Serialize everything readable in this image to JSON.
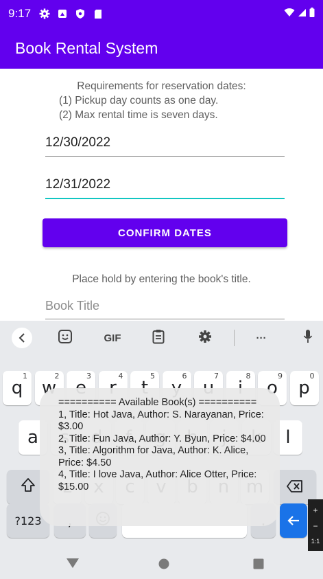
{
  "status_bar": {
    "time": "9:17",
    "icons": [
      "gear-icon",
      "screenshot-icon",
      "shield-icon",
      "sd-card-icon"
    ],
    "right_icons": [
      "wifi-icon",
      "signal-icon",
      "battery-icon"
    ]
  },
  "app_bar": {
    "title": "Book Rental System"
  },
  "requirements": {
    "heading": "Requirements for reservation dates:",
    "rule1": "(1) Pickup day counts as one day.",
    "rule2": "(2) Max rental time is seven days."
  },
  "pickup_date": {
    "value": "12/30/2022"
  },
  "return_date": {
    "value": "12/31/2022"
  },
  "confirm_button": {
    "label": "CONFIRM DATES"
  },
  "hold_hint": "Place hold by entering the book's title.",
  "book_title_input": {
    "placeholder": "Book Title",
    "value": ""
  },
  "keyboard": {
    "toolbar": {
      "gif_label": "GIF",
      "more_label": "···"
    },
    "row1": [
      {
        "key": "q",
        "num": "1"
      },
      {
        "key": "w",
        "num": "2"
      },
      {
        "key": "e",
        "num": "3"
      },
      {
        "key": "r",
        "num": "4"
      },
      {
        "key": "t",
        "num": "5"
      },
      {
        "key": "y",
        "num": "6"
      },
      {
        "key": "u",
        "num": "7"
      },
      {
        "key": "i",
        "num": "8"
      },
      {
        "key": "o",
        "num": "9"
      },
      {
        "key": "p",
        "num": "0"
      }
    ],
    "row2": [
      "a",
      "s",
      "d",
      "f",
      "g",
      "h",
      "j",
      "k",
      "l"
    ],
    "row3": [
      "z",
      "x",
      "c",
      "v",
      "b",
      "n",
      "m"
    ],
    "symbols_label": "?123",
    "comma_label": ",",
    "period_label": "."
  },
  "toast": {
    "header": "========== Available Book(s) ==========",
    "books": [
      "1, Title: Hot Java, Author: S. Narayanan, Price: $3.00",
      "2, Title: Fun Java, Author: Y. Byun, Price: $4.00",
      "3, Title: Algorithm for Java, Author: K. Alice, Price: $4.50",
      "4, Title: I love Java, Author: Alice Otter, Price: $15.00"
    ]
  },
  "side_tool": {
    "plus": "+",
    "minus": "−",
    "ratio": "1:1"
  }
}
